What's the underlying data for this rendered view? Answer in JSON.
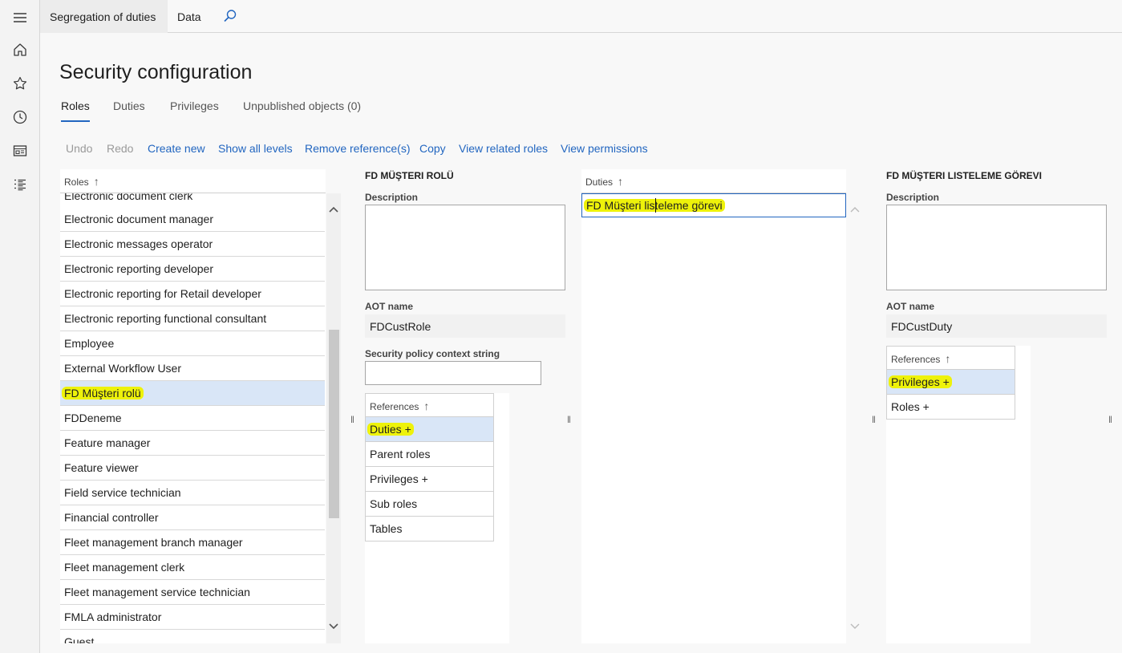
{
  "nav": {
    "tabs": [
      {
        "label": "Segregation of duties"
      },
      {
        "label": "Data"
      }
    ],
    "search_icon": "search-icon"
  },
  "rail": {
    "icons": [
      "hamburger-icon",
      "home-icon",
      "star-icon",
      "clock-icon",
      "workspace-icon",
      "list-icon"
    ]
  },
  "page": {
    "title": "Security configuration"
  },
  "tabs": [
    {
      "label": "Roles",
      "active": true
    },
    {
      "label": "Duties",
      "active": false
    },
    {
      "label": "Privileges",
      "active": false
    },
    {
      "label": "Unpublished objects (0)",
      "active": false
    }
  ],
  "actions": [
    {
      "label": "Undo",
      "enabled": false
    },
    {
      "label": "Redo",
      "enabled": false
    },
    {
      "label": "Create new",
      "enabled": true
    },
    {
      "label": "Show all levels",
      "enabled": true
    },
    {
      "label": "Remove reference(s)",
      "enabled": true
    },
    {
      "label": "Copy",
      "enabled": true
    },
    {
      "label": "View related roles",
      "enabled": true
    },
    {
      "label": "View permissions",
      "enabled": true
    }
  ],
  "roles": {
    "header": "Roles",
    "items": [
      "Electronic document clerk",
      "Electronic document manager",
      "Electronic messages operator",
      "Electronic reporting developer",
      "Electronic reporting for Retail developer",
      "Electronic reporting functional consultant",
      "Employee",
      "External Workflow User",
      "FD Müşteri rolü",
      "FDDeneme",
      "Feature manager",
      "Feature viewer",
      "Field service technician",
      "Financial controller",
      "Fleet management branch manager",
      "Fleet management clerk",
      "Fleet management service technician",
      "FMLA administrator",
      "Guest"
    ],
    "selected": "FD Müşteri rolü"
  },
  "role_detail": {
    "title": "FD MÜŞTERI ROLÜ",
    "description_label": "Description",
    "description_value": "",
    "aot_label": "AOT name",
    "aot_value": "FDCustRole",
    "policy_label": "Security policy context string",
    "policy_value": "",
    "references_header": "References",
    "references": [
      "Duties +",
      "Parent roles",
      "Privileges +",
      "Sub roles",
      "Tables"
    ],
    "selected_reference": "Duties +"
  },
  "duties": {
    "header": "Duties",
    "items": [
      "FD Müşteri listeleme görevi"
    ]
  },
  "duty_detail": {
    "title": "FD MÜŞTERI LISTELEME GÖREVI",
    "description_label": "Description",
    "description_value": "",
    "aot_label": "AOT name",
    "aot_value": "FDCustDuty",
    "references_header": "References",
    "references": [
      "Privileges +",
      "Roles +"
    ],
    "selected_reference": "Privileges +"
  },
  "colors": {
    "accent": "#2266c0",
    "selected_row": "#d9e6f7",
    "highlight": "#eef20a"
  }
}
